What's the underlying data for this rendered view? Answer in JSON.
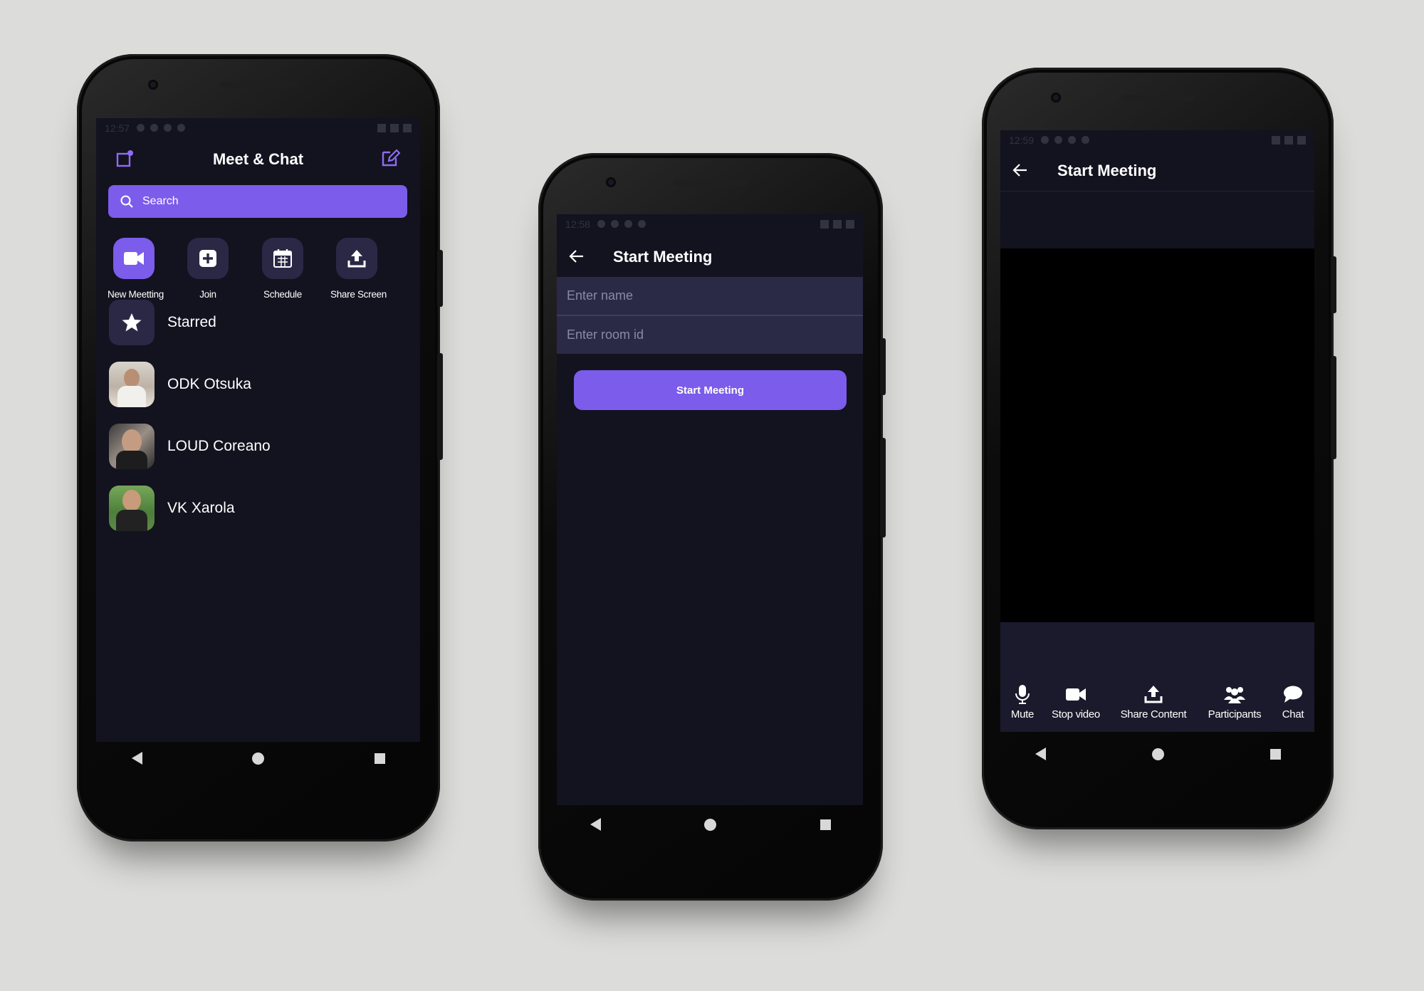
{
  "phone1": {
    "status_time": "12:57",
    "title": "Meet & Chat",
    "search_placeholder": "Search",
    "actions": [
      {
        "label": "New Meetting",
        "icon": "video-camera-icon"
      },
      {
        "label": "Join",
        "icon": "plus-icon"
      },
      {
        "label": "Schedule",
        "icon": "calendar-icon"
      },
      {
        "label": "Share Screen",
        "icon": "upload-icon"
      }
    ],
    "contacts": [
      {
        "name": "Starred",
        "icon": "star-icon"
      },
      {
        "name": "ODK Otsuka"
      },
      {
        "name": "LOUD Coreano"
      },
      {
        "name": "VK Xarola"
      }
    ]
  },
  "phone2": {
    "status_time": "12:58",
    "title": "Start Meeting",
    "name_placeholder": "Enter name",
    "room_placeholder": "Enter room id",
    "button_label": "Start Meeting"
  },
  "phone3": {
    "status_time": "12:59",
    "title": "Start Meeting",
    "controls": [
      {
        "label": "Mute",
        "icon": "microphone-icon"
      },
      {
        "label": "Stop video",
        "icon": "video-camera-icon"
      },
      {
        "label": "Share Content",
        "icon": "upload-icon"
      },
      {
        "label": "Participants",
        "icon": "participants-icon"
      },
      {
        "label": "Chat",
        "icon": "chat-bubble-icon"
      }
    ]
  },
  "colors": {
    "accent": "#7b5ceb",
    "screen_bg": "#13121f",
    "input_bg": "#2a2946",
    "page_bg": "#dcdcda"
  }
}
